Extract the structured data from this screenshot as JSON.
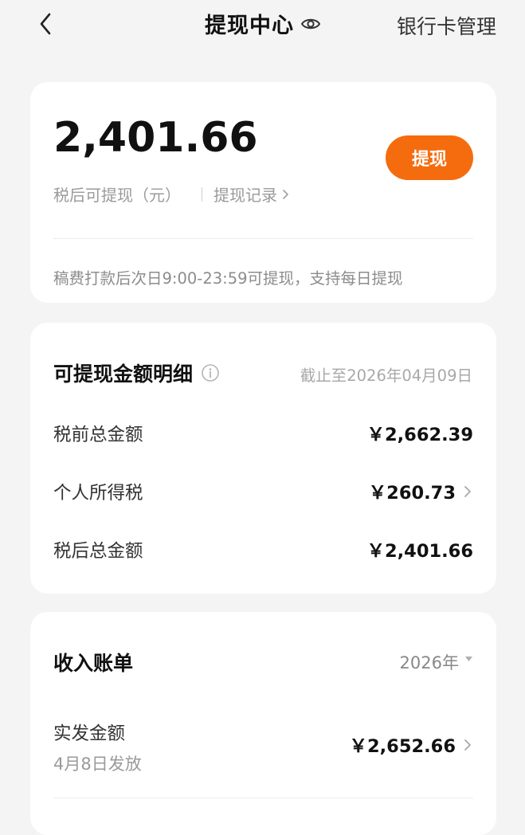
{
  "header": {
    "title": "提现中心",
    "bank_manage": "银行卡管理"
  },
  "balance": {
    "amount": "2,401.66",
    "label": "税后可提现（元）",
    "record_link": "提现记录",
    "withdraw_button": "提现",
    "notice": "稿费打款后次日9:00-23:59可提现，支持每日提现"
  },
  "detail": {
    "title": "可提现金额明细",
    "as_of": "截止至2026年04月09日",
    "rows": [
      {
        "label": "税前总金额",
        "value": "￥2,662.39"
      },
      {
        "label": "个人所得税",
        "value": "￥260.73"
      },
      {
        "label": "税后总金额",
        "value": "￥2,401.66"
      }
    ]
  },
  "income": {
    "title": "收入账单",
    "year": "2026年",
    "items": [
      {
        "label": "实发金额",
        "date": "4月8日发放",
        "value": "￥2,652.66"
      }
    ]
  },
  "colors": {
    "accent": "#f56c0f",
    "background": "#f4f4f4",
    "card": "#ffffff"
  },
  "icons": [
    "back-icon",
    "eye-icon",
    "chevron-right-icon",
    "info-icon",
    "dropdown-triangle-icon"
  ]
}
